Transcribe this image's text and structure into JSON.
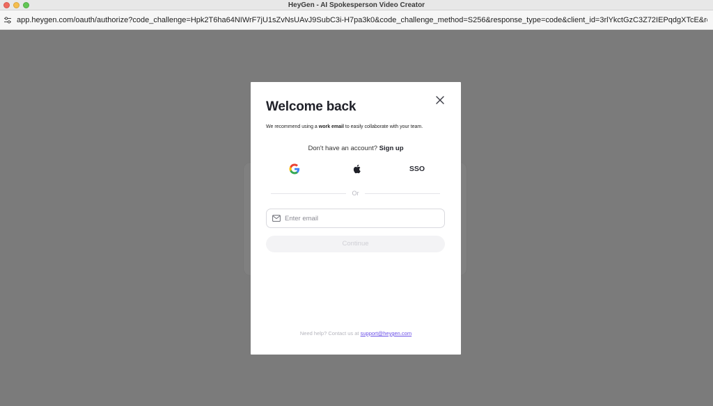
{
  "window": {
    "title": "HeyGen - AI Spokesperson Video Creator"
  },
  "address_bar": {
    "url": "app.heygen.com/oauth/authorize?code_challenge=Hpk2T6ha64NIWrF7jU1sZvNsUAvJ9SubC3i-H7pa3k0&code_challenge_method=S256&response_type=code&client_id=3rlYkctGzC3Z72IEPqdgXTcE&redire..."
  },
  "modal": {
    "heading": "Welcome back",
    "subtext_prefix": "We recommend using a ",
    "subtext_bold": "work email",
    "subtext_suffix": " to easily collaborate with your team.",
    "signup_prompt": "Don't have an account?",
    "signup_link": "Sign up",
    "providers": {
      "google_icon": "google-logo",
      "apple_icon": "apple-logo",
      "sso_label": "SSO"
    },
    "divider_text": "Or",
    "email": {
      "placeholder": "Enter email",
      "value": "",
      "icon": "mail-icon"
    },
    "continue_label": "Continue",
    "help_prefix": "Need help? Contact us at",
    "support_email": "support@heygen.com"
  },
  "colors": {
    "backdrop": "#7b7b7b",
    "link_accent": "#6a4fe8",
    "continue_disabled_bg": "#f3f3f5"
  }
}
